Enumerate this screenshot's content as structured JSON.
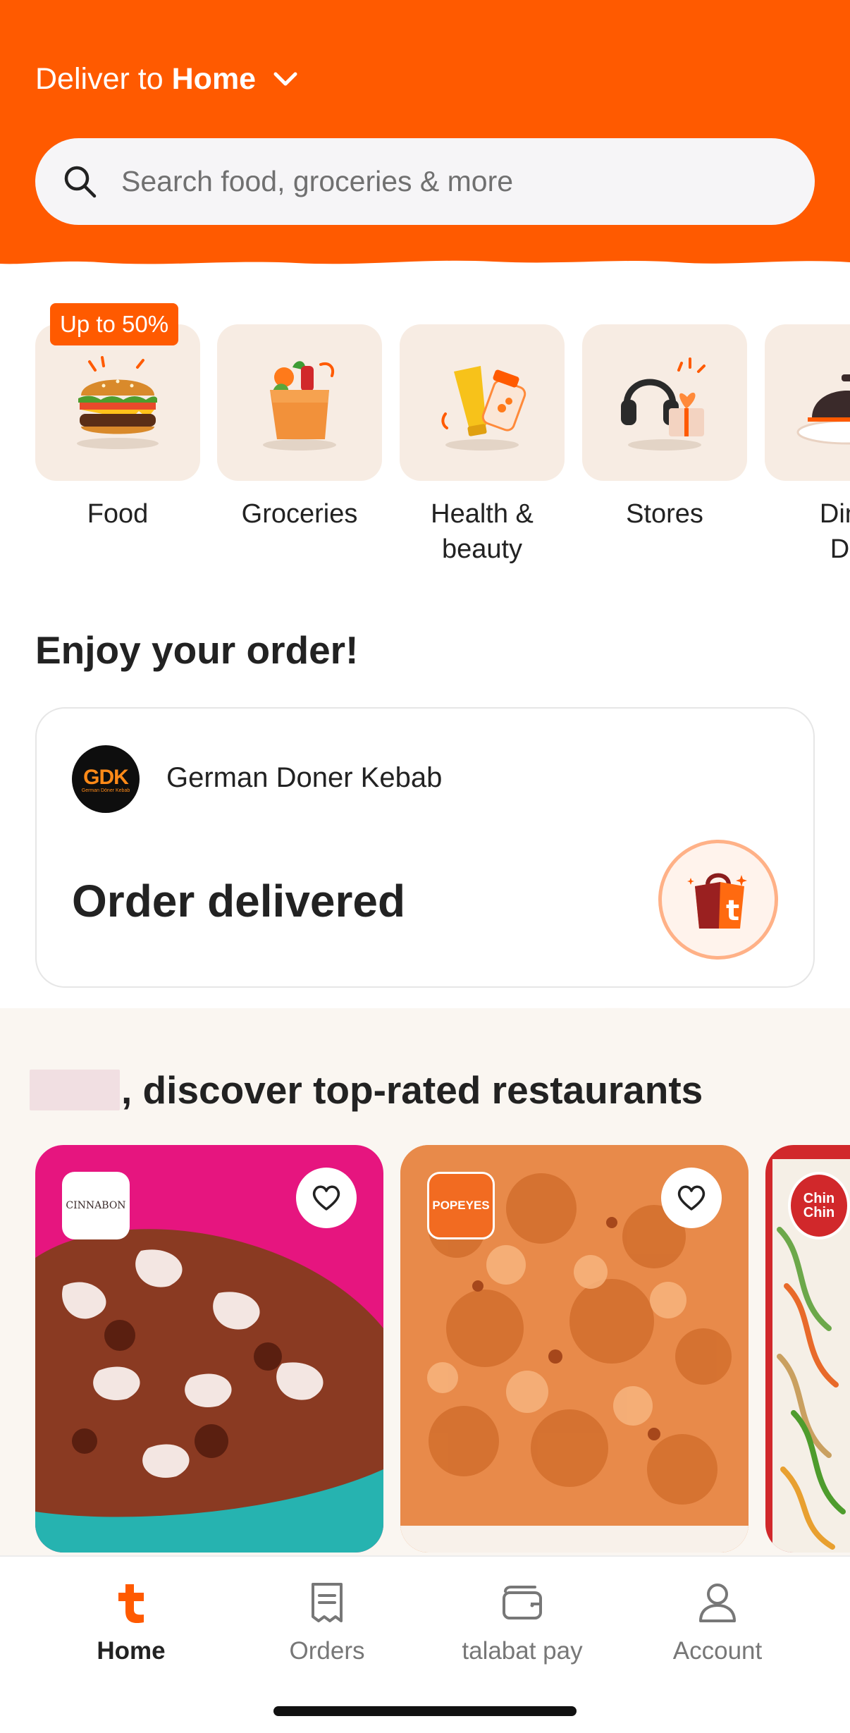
{
  "colors": {
    "brand": "#ff5a00",
    "badge": "#ff5a00",
    "text": "#222222",
    "muted": "#777777"
  },
  "header": {
    "deliver_prefix": "Deliver to",
    "deliver_location": "Home",
    "search_placeholder": "Search food, groceries & more"
  },
  "categories": [
    {
      "label": "Food",
      "badge": "Up to 50%",
      "icon": "burger-icon"
    },
    {
      "label": "Groceries",
      "icon": "grocery-bag-icon"
    },
    {
      "label": "Health &\nbeauty",
      "icon": "beauty-products-icon"
    },
    {
      "label": "Stores",
      "icon": "headphones-gift-icon"
    },
    {
      "label": "Dine\nDe",
      "icon": "cloche-icon"
    }
  ],
  "enjoy": {
    "title": "Enjoy your order!",
    "restaurant": "German Doner Kebab",
    "logo_text": "GDK",
    "logo_subtext": "German Döner Kebab",
    "status": "Order delivered"
  },
  "discover": {
    "title": ", discover top-rated restaurants",
    "restaurants": [
      {
        "logo_text": "CINNABON",
        "icon": "heart-icon"
      },
      {
        "logo_text": "POPEYES",
        "icon": "heart-icon"
      },
      {
        "logo_text": "Chin Chin",
        "icon": "heart-icon"
      }
    ]
  },
  "nav": {
    "items": [
      {
        "label": "Home",
        "icon": "talabat-home-icon",
        "active": true
      },
      {
        "label": "Orders",
        "icon": "receipt-icon"
      },
      {
        "label": "talabat pay",
        "icon": "wallet-icon"
      },
      {
        "label": "Account",
        "icon": "person-icon"
      }
    ]
  }
}
